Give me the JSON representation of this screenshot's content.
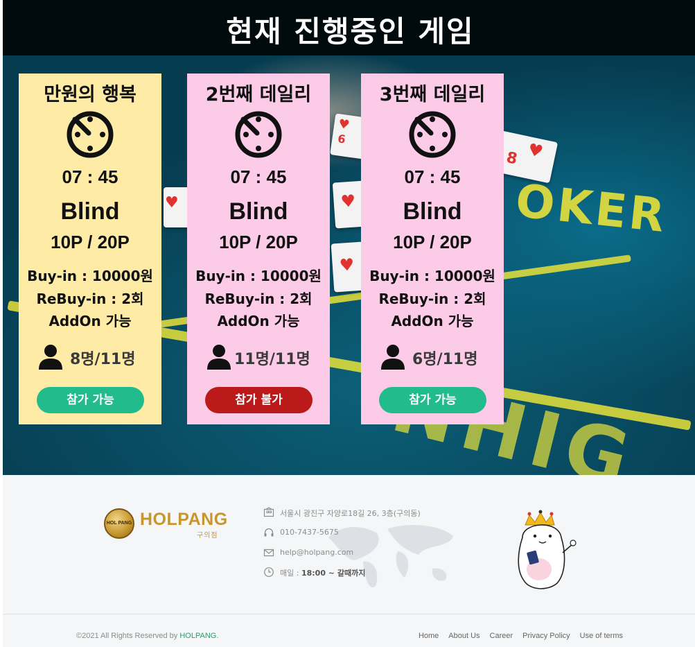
{
  "hero": {
    "title": "현재 진행중인 게임"
  },
  "games": [
    {
      "name": "만원의 행복",
      "time": "07 : 45",
      "blind_label": "Blind",
      "stakes": "10P / 20P",
      "buy_in": "Buy-in : 10000원",
      "rebuy": "ReBuy-in : 2회",
      "addon": "AddOn 가능",
      "players": "8명/11명",
      "button_label": "참가 가능",
      "status": "open",
      "card_color": "#fdeba6"
    },
    {
      "name": "2번째 데일리",
      "time": "07 : 45",
      "blind_label": "Blind",
      "stakes": "10P / 20P",
      "buy_in": "Buy-in : 10000원",
      "rebuy": "ReBuy-in : 2회",
      "addon": "AddOn 가능",
      "players": "11명/11명",
      "button_label": "참가 불가",
      "status": "closed",
      "card_color": "#fccbe8"
    },
    {
      "name": "3번째 데일리",
      "time": "07 : 45",
      "blind_label": "Blind",
      "stakes": "10P / 20P",
      "buy_in": "Buy-in : 10000원",
      "rebuy": "ReBuy-in : 2회",
      "addon": "AddOn 가능",
      "players": "6명/11명",
      "button_label": "참가 가능",
      "status": "open",
      "card_color": "#fccbe8"
    }
  ],
  "footer": {
    "logo": {
      "badge_text": "HOL PANG",
      "wordmark": "HOLPANG",
      "branch": "구의점"
    },
    "info": {
      "address": "서울시 광진구 자양로18길 26, 3층(구의동)",
      "phone": "010-7437-5675",
      "email": "help@holpang.com",
      "hours_label": "매일 : ",
      "hours_value": "18:00 ~ 갈때까지"
    },
    "copyright_prefix": "©2021 All Rights Reserved by ",
    "copyright_brand": "HOLPANG",
    "copyright_suffix": ".",
    "nav": [
      "Home",
      "About Us",
      "Career",
      "Privacy Policy",
      "Use of terms"
    ]
  },
  "colors": {
    "button_open": "#22bb8c",
    "button_closed": "#bb1a1a",
    "card_yellow": "#fdeba6",
    "card_pink": "#fccbe8",
    "brand_gold": "#c8962f",
    "brand_green": "#1fa36a"
  },
  "icons": {
    "timer": "timer-icon",
    "players": "person-icon",
    "address": "building-icon",
    "phone": "headset-icon",
    "email": "mail-icon",
    "hours": "clock-icon"
  }
}
